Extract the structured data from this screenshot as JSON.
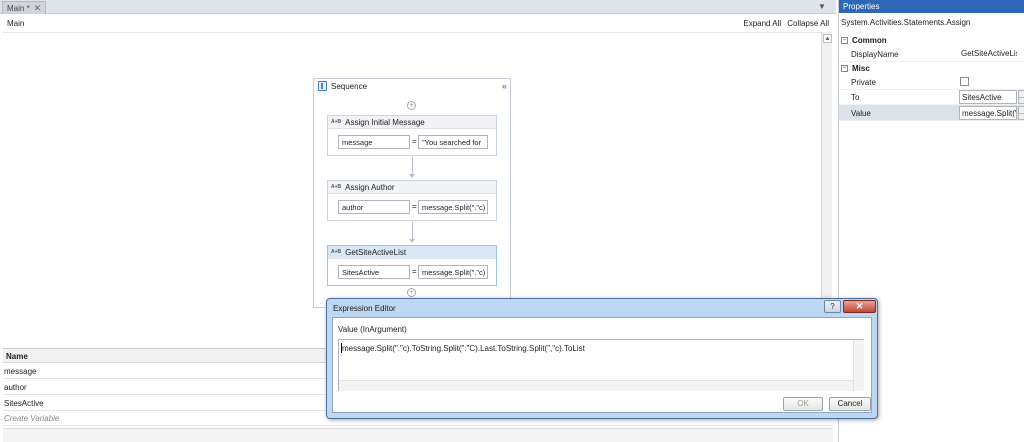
{
  "tabs": {
    "active_tab": "Main *"
  },
  "designer": {
    "breadcrumb": "Main",
    "expand_all": "Expand All",
    "collapse_all": "Collapse All"
  },
  "sequence": {
    "title": "Sequence",
    "activities": [
      {
        "ab": "A+B",
        "title": "Assign Initial Message",
        "to": "message",
        "value": "\"You searched for"
      },
      {
        "ab": "A+B",
        "title": "Assign Author",
        "to": "author",
        "value": "message.Split(\".\"c)"
      },
      {
        "ab": "A+B",
        "title": "GetSiteActiveList",
        "to": "SitesActive",
        "value": "message.Split(\".\"c)"
      }
    ]
  },
  "variables": {
    "header": "Name",
    "rows": [
      "message",
      "author",
      "SitesActive"
    ],
    "create": "Create Variable"
  },
  "properties": {
    "title": "Properties",
    "type_name": "System.Activities.Statements.Assign",
    "common_label": "Common",
    "misc_label": "Misc",
    "display_name_label": "DisplayName",
    "display_name_value": "GetSiteActiveList",
    "private_label": "Private",
    "to_label": "To",
    "to_value": "SitesActive",
    "value_label": "Value",
    "value_value": "message.Split(\""
  },
  "dialog": {
    "title": "Expression Editor",
    "help": "?",
    "label": "Value (InArgument)",
    "expression": "message.Split(\".\"c).ToString.Split(\":\"C).Last.ToString.Split(\",\"c).ToList",
    "ok": "OK",
    "cancel": "Cancel"
  }
}
